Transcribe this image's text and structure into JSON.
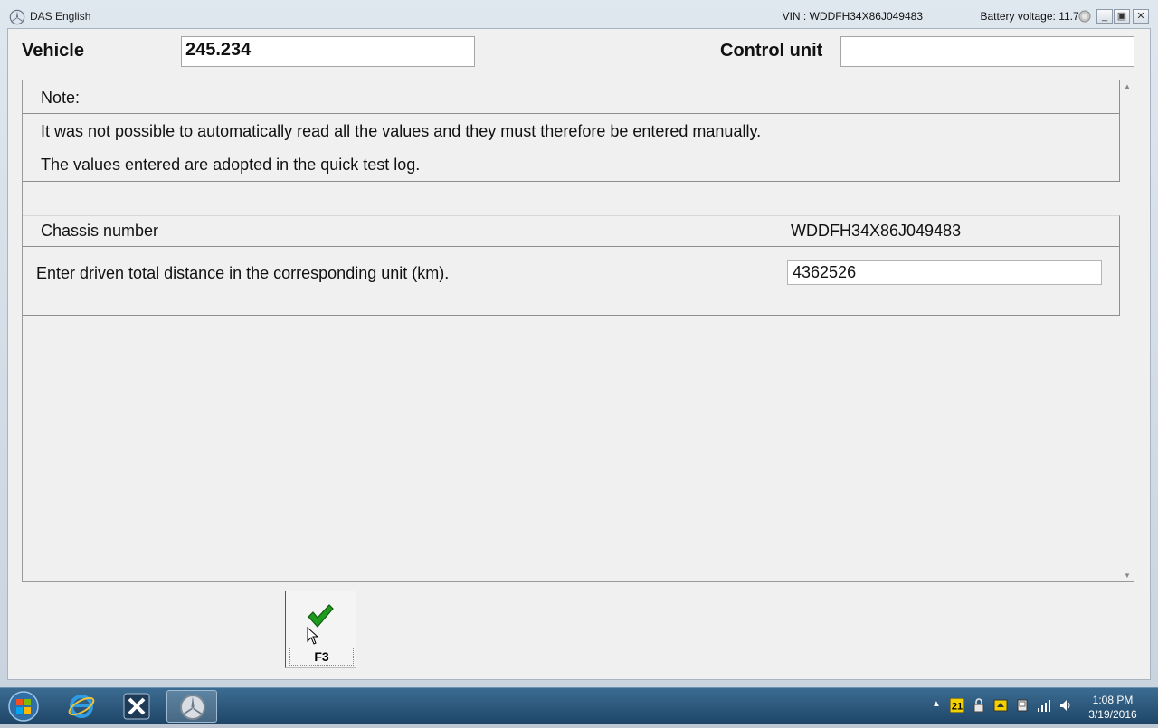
{
  "window": {
    "title": "DAS English",
    "vin": "VIN : WDDFH34X86J049483",
    "battery": "Battery voltage: 11.7 V",
    "controls": {
      "minimize": "_",
      "restore": "▣",
      "close": "✕"
    }
  },
  "header": {
    "vehicle_label": "Vehicle",
    "vehicle_value": "245.234",
    "control_unit_label": "Control unit",
    "control_unit_value": ""
  },
  "content": {
    "note_label": "Note:",
    "info_line1": "It was not possible to automatically read all the values and they must therefore be entered manually.",
    "info_line2": "The values entered are adopted in the quick test log.",
    "chassis_label": "Chassis number",
    "chassis_value": "WDDFH34X86J049483",
    "distance_label": "Enter driven total distance in the corresponding unit (km).",
    "distance_value": "4362526"
  },
  "actions": {
    "f3_label": "F3",
    "f3_icon": "checkmark-icon"
  },
  "taskbar": {
    "clock_time": "1:08 PM",
    "clock_date": "3/19/2016",
    "tray_badge": "21",
    "icons": [
      "windows-start-icon",
      "internet-explorer-icon",
      "xentry-icon",
      "mercedes-star-icon"
    ]
  },
  "colors": {
    "check": "#1f9a1f",
    "taskbar": "#2a5478",
    "window_bg": "#f0f0f0"
  }
}
